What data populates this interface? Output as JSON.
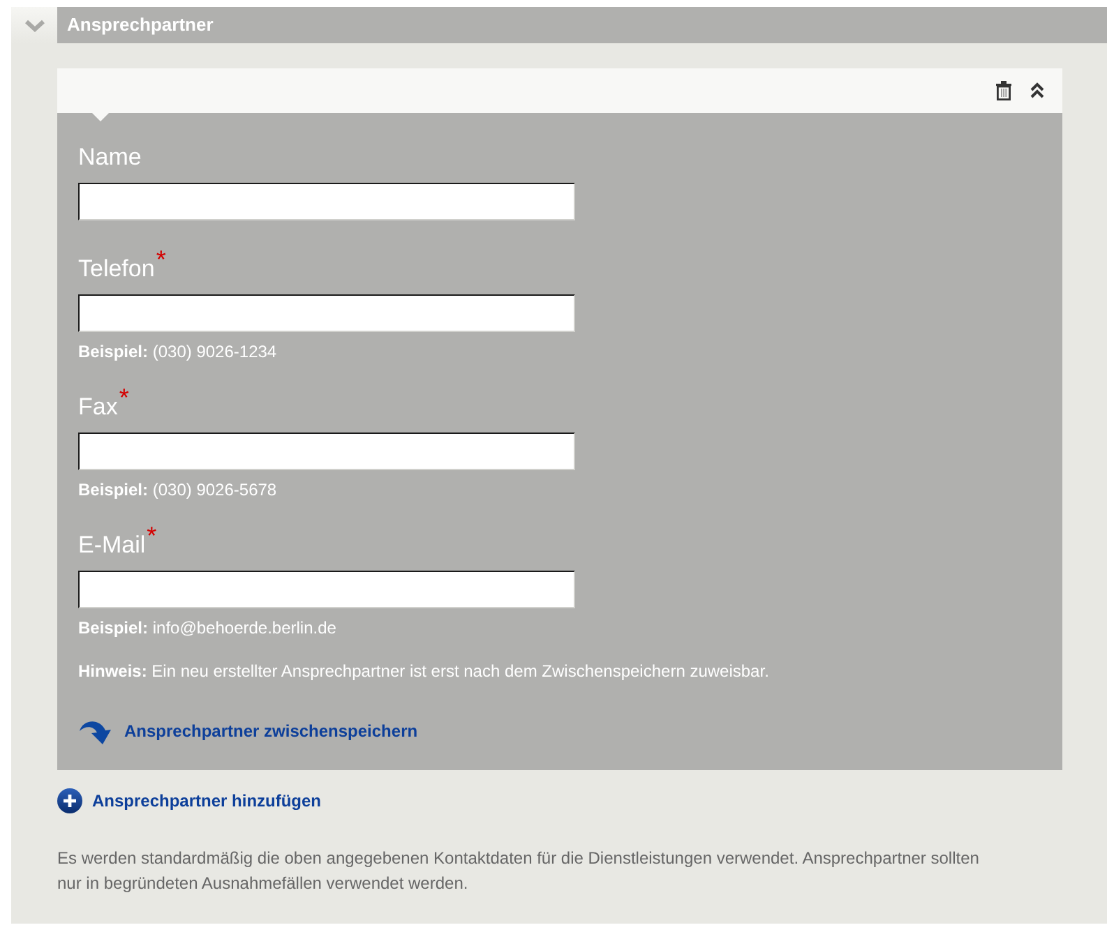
{
  "section": {
    "title": "Ansprechpartner",
    "expanded": true
  },
  "contact_card": {
    "expanded": true,
    "fields": [
      {
        "label": "Name"
      },
      {
        "label": "Telefon",
        "required_mark": "*",
        "hint": "**Beispiel:** (030) 9026-1234"
      },
      {
        "label": "Fax",
        "required_mark": "*",
        "hint": "**Beispiel:** (030) 9026-5678"
      },
      {
        "label": "E-Mail",
        "required_mark": "*",
        "hint": "**Beispiel:** info@behoerde.berlin.de"
      }
    ],
    "note": "**Hinweis:** Ein neu erstellter Ansprechpartner ist erst nach dem Zwischenspeichern zuweisbar.",
    "save_link": "Ansprechpartner zwischenspeichern"
  },
  "add_link": "Ansprechpartner hinzufügen",
  "info_text": "Es werden standardmäßig die oben angegebenen Kontaktdaten für die Dienstleistungen verwendet. Ansprechpartner sollten nur in begründeten Ausnahmefällen verwendet werden."
}
